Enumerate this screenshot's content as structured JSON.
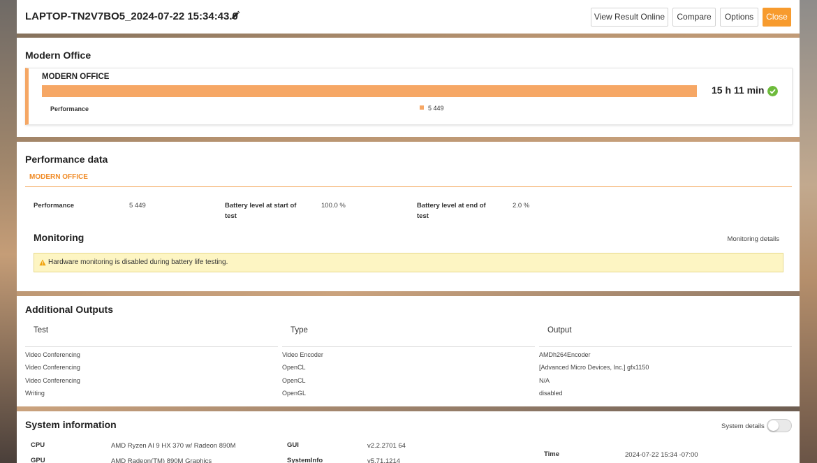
{
  "header": {
    "title": "LAPTOP-TN2V7BO5_2024-07-22 15:34:43.0",
    "buttons": {
      "view_online": "View Result Online",
      "compare": "Compare",
      "options": "Options",
      "close": "Close"
    }
  },
  "modern_office": {
    "section_title": "Modern Office",
    "card_title": "MODERN OFFICE",
    "score": "15 h 11 min",
    "metric_label": "Performance",
    "metric_value": "5 449"
  },
  "performance_data": {
    "section_title": "Performance data",
    "tab": "MODERN OFFICE",
    "fields": [
      {
        "label": "Performance",
        "value": "5 449"
      },
      {
        "label": "Battery level at start of test",
        "value": "100.0 %"
      },
      {
        "label": "Battery level at end of test",
        "value": "2.0 %"
      }
    ],
    "monitoring": {
      "title": "Monitoring",
      "details_link": "Monitoring details",
      "warning": "Hardware monitoring is disabled during battery life testing."
    }
  },
  "additional_outputs": {
    "section_title": "Additional Outputs",
    "columns": [
      "Test",
      "Type",
      "Output"
    ],
    "rows": [
      [
        "Video Conferencing",
        "Video Encoder",
        "AMDh264Encoder"
      ],
      [
        "Video Conferencing",
        "OpenCL",
        "[Advanced Micro Devices, Inc.] gfx1150"
      ],
      [
        "Video Conferencing",
        "OpenCL",
        "N/A"
      ],
      [
        "Writing",
        "OpenGL",
        "disabled"
      ]
    ]
  },
  "system_info": {
    "section_title": "System information",
    "details_toggle_label": "System details",
    "details_toggle_on": false,
    "rows": {
      "cpu": {
        "label": "CPU",
        "value": "AMD Ryzen AI 9 HX 370 w/ Radeon 890M"
      },
      "gpu": {
        "label": "GPU",
        "value": "AMD Radeon(TM) 890M Graphics"
      },
      "gui": {
        "label": "GUI",
        "value": "v2.2.2701 64"
      },
      "systeminfo": {
        "label": "SystemInfo",
        "value": "v5.71.1214"
      },
      "time": {
        "label": "Time",
        "value": "2024-07-22 15:34 -07:00"
      }
    }
  },
  "colors": {
    "accent": "#f79b2e",
    "bar": "#f6a765",
    "success": "#6dbb3b",
    "warning_bg": "#fdf5c3"
  },
  "icons": [
    "pencil-icon",
    "check-circle-icon",
    "warning-icon"
  ]
}
